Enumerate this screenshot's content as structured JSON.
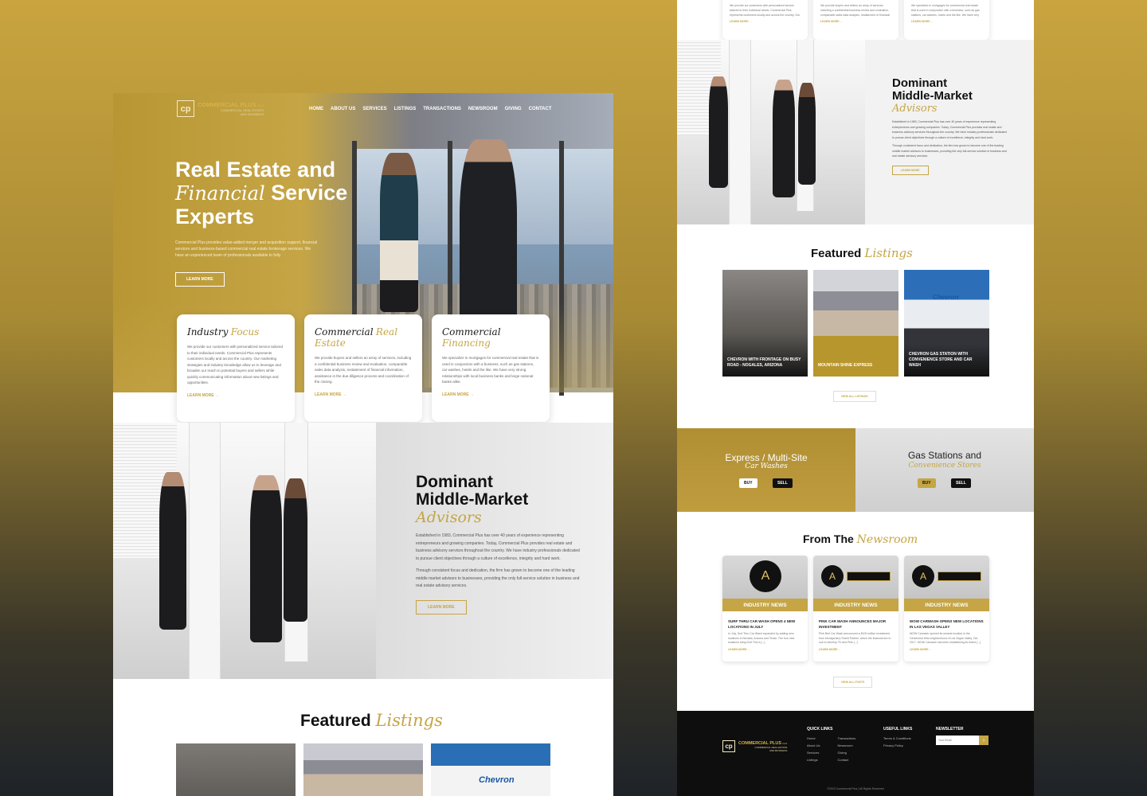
{
  "brand": {
    "mark": "cp",
    "name": "COMMERCIAL PLUS",
    "suffix": "LLC",
    "sub1": "COMMERCIAL REAL ESTATE",
    "sub2": "AND BUSINESS"
  },
  "nav": [
    "HOME",
    "ABOUT US",
    "SERVICES",
    "LISTINGS",
    "TRANSACTIONS",
    "NEWSROOM",
    "GIVING",
    "CONTACT"
  ],
  "hero": {
    "line1": "Real Estate and",
    "script": "Financial",
    "line2b": "Service",
    "line3": "Experts",
    "desc": "Commercial Plus provides value-added merger and acquisition support, financial services and business-based commercial real estate brokerage services. We have an experienced team of professionals available to fully",
    "btn": "LEARN MORE"
  },
  "cards": [
    {
      "a": "Industry",
      "b": "Focus",
      "body": "We provide our customers with personalized service tailored to their individual needs. Commercial Plus represents customers locally and across the country. Our marketing strategies and industry knowledge allow us to leverage and broaden our reach to potential buyers and sellers while quickly communicating information about new listings and opportunities.",
      "link": "LEARN MORE →"
    },
    {
      "a": "Commercial",
      "b": "Real Estate",
      "body": "We provide buyers and sellers an array of services, including a confidential business review and evaluation, comparable sales data analysis, restatement of financial information, assistance in the due diligence process and coordination of the closing.",
      "link": "LEARN MORE →"
    },
    {
      "a": "Commercial",
      "b": "Financing",
      "body": "We specialize in mortgages for commercial real estate that is used in conjunction with a business, such as gas stations, car washes, hotels and the like. We have very strong relationships with local business banks and large national banks alike.",
      "link": "LEARN MORE →"
    }
  ],
  "dominant": {
    "l1": "Dominant",
    "l2": "Middle-Market",
    "script": "Advisors",
    "p1": "Established in 1983, Commercial Plus has over 40 years of experience representing entrepreneurs and growing companies. Today, Commercial Plus provides real estate and business advisory services throughout the country. We have industry professionals dedicated to pursue client objectives through a culture of excellence, integrity and hard work.",
    "p2": "Through consistent focus and dedication, the firm has grown to become one of the leading middle market advisors to businesses, providing the only full-service solution in business and real estate advisory services.",
    "btn": "LEARN MORE"
  },
  "featured": {
    "a": "Featured",
    "b": "Listings",
    "viewall": "VIEW ALL LISTINGS"
  },
  "listings": [
    {
      "caption": "CHEVRON WITH FRONTAGE ON BUSY ROAD - NOGALES, ARIZONA"
    },
    {
      "caption": "MOUNTAIN SHINE EXPRESS"
    },
    {
      "caption": "CHEVRON GAS STATION WITH CONVENIENCE STORE AND CAR WASH"
    }
  ],
  "chevron_sign": "Chevron",
  "banners": [
    {
      "l1": "Express / Multi-Site",
      "script": "Car Washes",
      "buy": "BUY",
      "sell": "SELL"
    },
    {
      "l1": "Gas Stations and",
      "script": "Convenience Stores",
      "buy": "BUY",
      "sell": "SELL"
    }
  ],
  "newsroom": {
    "a": "From The",
    "b": "Newsroom",
    "viewall": "VIEW ALL POSTS"
  },
  "news": [
    {
      "badge": "INDUSTRY NEWS",
      "title": "SURF THRU CAR WASH OPENS 4 NEW LOCATIONS IN JULY",
      "text": "In July, Surf Thru Car Wash expanded by adding new locations in Nevada, Arizona and Texas. The four new locations bring Surf Thru's [...]",
      "link": "LEARN MORE →"
    },
    {
      "badge": "INDUSTRY NEWS",
      "title": "PINK CAR WASH ANNOUNCES MAJOR INVESTMENT",
      "text": "Pink Bird Car Wash announced a $100 million investment from Montgomery Street Partner, which the financial are to use to develop 75 new Pink [...]",
      "link": "LEARN MORE →"
    },
    {
      "badge": "INDUSTRY NEWS",
      "title": "WOW CARWASH OPENS NEW LOCATIONS IN LAS VEGAS VALLEY",
      "text": "WOW Carwash opened its newest location in the Centennial Hills neighborhood of Las Vegas Valley, Oct. 2017. WOW Carwash has been establishing its brand [...]",
      "link": "LEARN MORE →"
    }
  ],
  "footer": {
    "quick_h": "QUICK LINKS",
    "quick1": [
      "Home",
      "About Us",
      "Services",
      "Listings"
    ],
    "quick2": [
      "Transactions",
      "Newsroom",
      "Giving",
      "Contact"
    ],
    "useful_h": "USEFUL LINKS",
    "useful": [
      "Terms & Conditions",
      "Privacy Policy"
    ],
    "news_h": "NEWSLETTER",
    "email_ph": "Your Email",
    "copyright": "©2023 Commercial Plus | All Rights Reserved"
  },
  "colors": {
    "gold": "#c5a545",
    "dark": "#0e0e0e"
  }
}
